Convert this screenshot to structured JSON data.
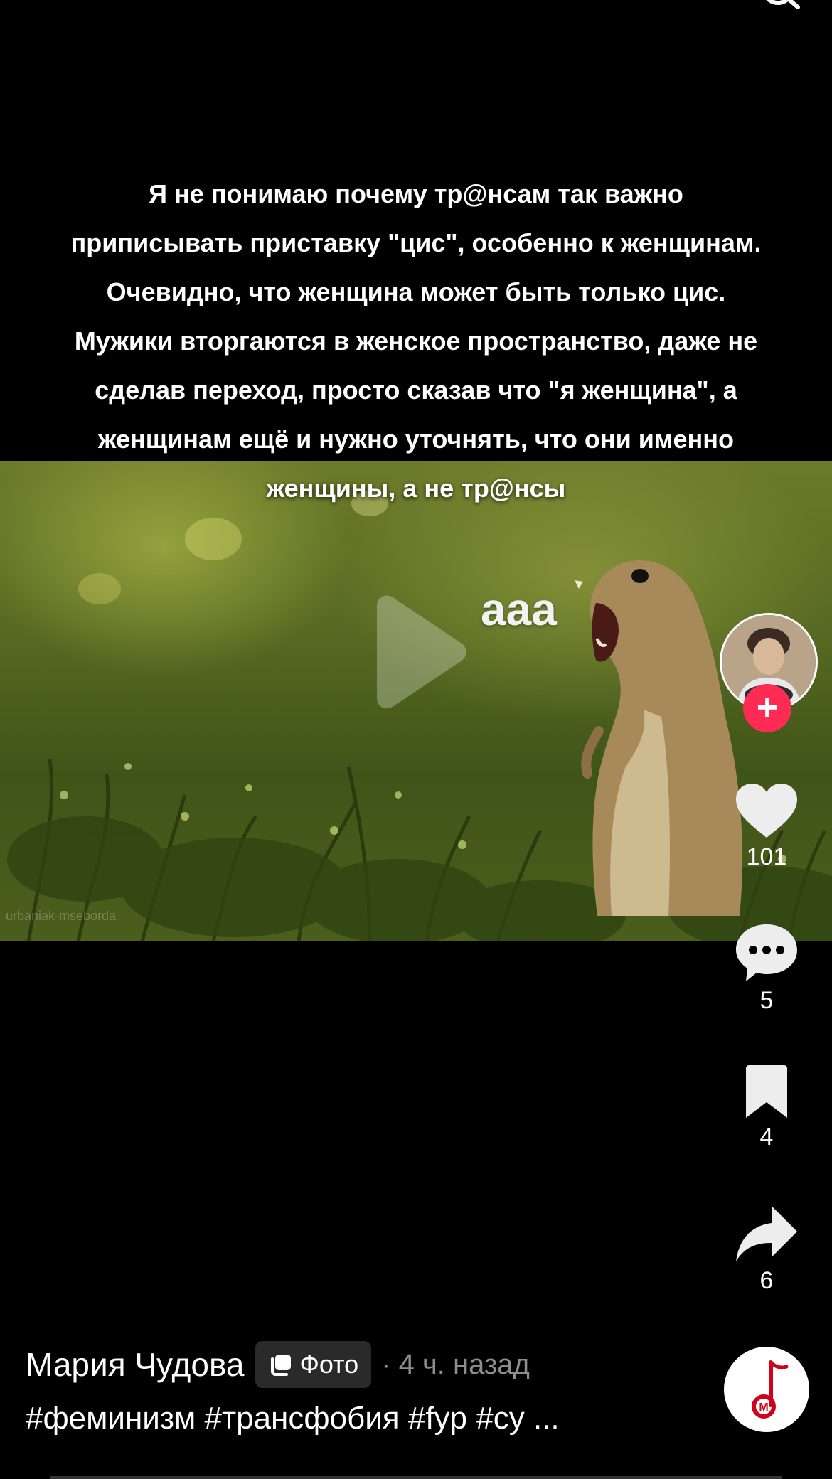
{
  "caption": {
    "lines": [
      "Я не понимаю почему тр@нсам так важно",
      "приписывать приставку \"цис\", особенно к женщинам.",
      "Очевидно, что женщина может быть только цис.",
      "Мужики вторгаются в женское пространство, даже не",
      "сделав переход, просто сказав что \"я женщина\", а",
      "женщинам ещё и нужно уточнять, что они именно",
      "женщины, а не тр@нсы"
    ]
  },
  "image": {
    "overlay_text": "ааа",
    "watermark": "urbaniak-mseborda"
  },
  "actions": {
    "likes": "101",
    "comments": "5",
    "saves": "4",
    "shares": "6"
  },
  "post": {
    "author": "Мария Чудова",
    "badge": "Фото",
    "time": "· 4 ч. назад",
    "hashtags": "#феминизм #трансфобия #fyp #cy ..."
  },
  "colors": {
    "accent": "#fe2c55",
    "background": "#000000",
    "muted": "#8e8e8e"
  },
  "icons": [
    "back-icon",
    "search-icon",
    "play-icon",
    "heart-icon",
    "comment-icon",
    "bookmark-icon",
    "share-icon",
    "music-disc-icon"
  ]
}
